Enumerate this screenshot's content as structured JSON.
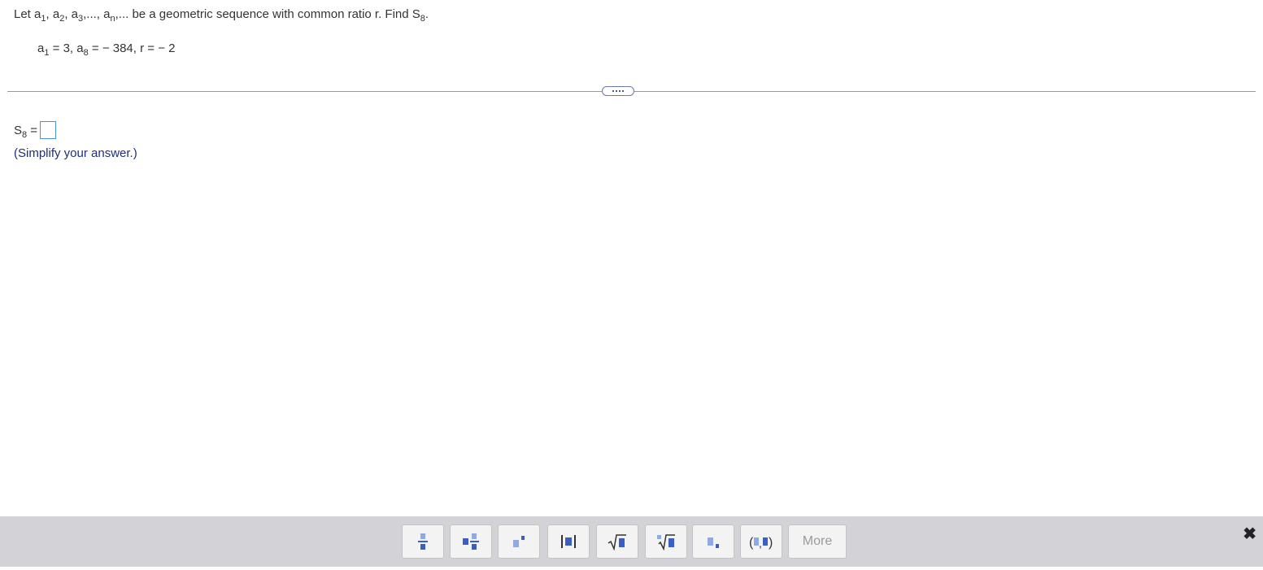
{
  "problem": {
    "prefix": "Let a",
    "items": [
      "1",
      ", a",
      "2",
      ", a",
      "3",
      ",..., a",
      "n",
      ",... be a geometric sequence with common ratio r.  Find S",
      "8",
      "."
    ]
  },
  "given": {
    "a1_label": "a",
    "a1_sub": "1",
    "a1_val": " = 3, a",
    "a8_sub": "8",
    "rest": " =  − 384, r =  − 2"
  },
  "answer": {
    "label": "S",
    "label_sub": "8",
    "equals": " ="
  },
  "hint": "(Simplify your answer.)",
  "toolbar": {
    "more_label": "More",
    "icons": [
      "fraction-icon",
      "mixed-number-icon",
      "exponent-icon",
      "absolute-value-icon",
      "square-root-icon",
      "nth-root-icon",
      "subscript-icon",
      "ordered-pair-icon"
    ],
    "close_glyph": "✖"
  },
  "colors": {
    "icon_dark": "#3a5fc4",
    "icon_light": "#8fa9e6",
    "toolbar_bg": "#d3d3d7"
  }
}
